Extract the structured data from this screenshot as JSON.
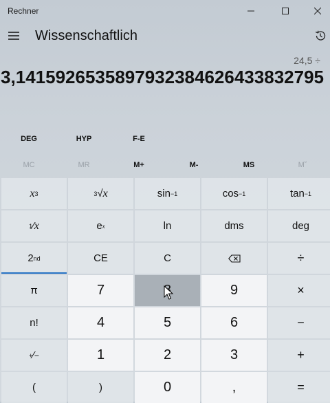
{
  "app": {
    "title": "Rechner"
  },
  "header": {
    "mode": "Wissenschaftlich"
  },
  "display": {
    "expression": "24,5 ÷",
    "value": "3,1415926535897932384626433832795"
  },
  "modes": {
    "angle": "DEG",
    "hyp": "HYP",
    "fe": "F-E"
  },
  "memory": [
    "MC",
    "MR",
    "M+",
    "M-",
    "MS",
    "M˘"
  ],
  "keys": {
    "r1": [
      "x³",
      "∛x",
      "sin⁻¹",
      "cos⁻¹",
      "tan⁻¹"
    ],
    "r2": [
      "¹⁄x",
      "eˣ",
      "ln",
      "dms",
      "deg"
    ],
    "r3": [
      "2nd",
      "CE",
      "C",
      "⌫",
      "÷"
    ],
    "r4": [
      "π",
      "7",
      "8",
      "9",
      "×"
    ],
    "r5": [
      "n!",
      "4",
      "5",
      "6",
      "−"
    ],
    "r6": [
      "⁺⁄₋",
      "1",
      "2",
      "3",
      "+"
    ],
    "r7": [
      "(",
      ")",
      "0",
      ",",
      "="
    ]
  },
  "icons": {
    "minimize": "minimize-icon",
    "maximize": "maximize-icon",
    "close": "close-icon",
    "menu": "hamburger-icon",
    "history": "history-icon",
    "backspace": "backspace-icon"
  },
  "colors": {
    "accent": "#2672c4",
    "numpad": "#f3f4f6",
    "keypad": "#e2e6ea"
  }
}
